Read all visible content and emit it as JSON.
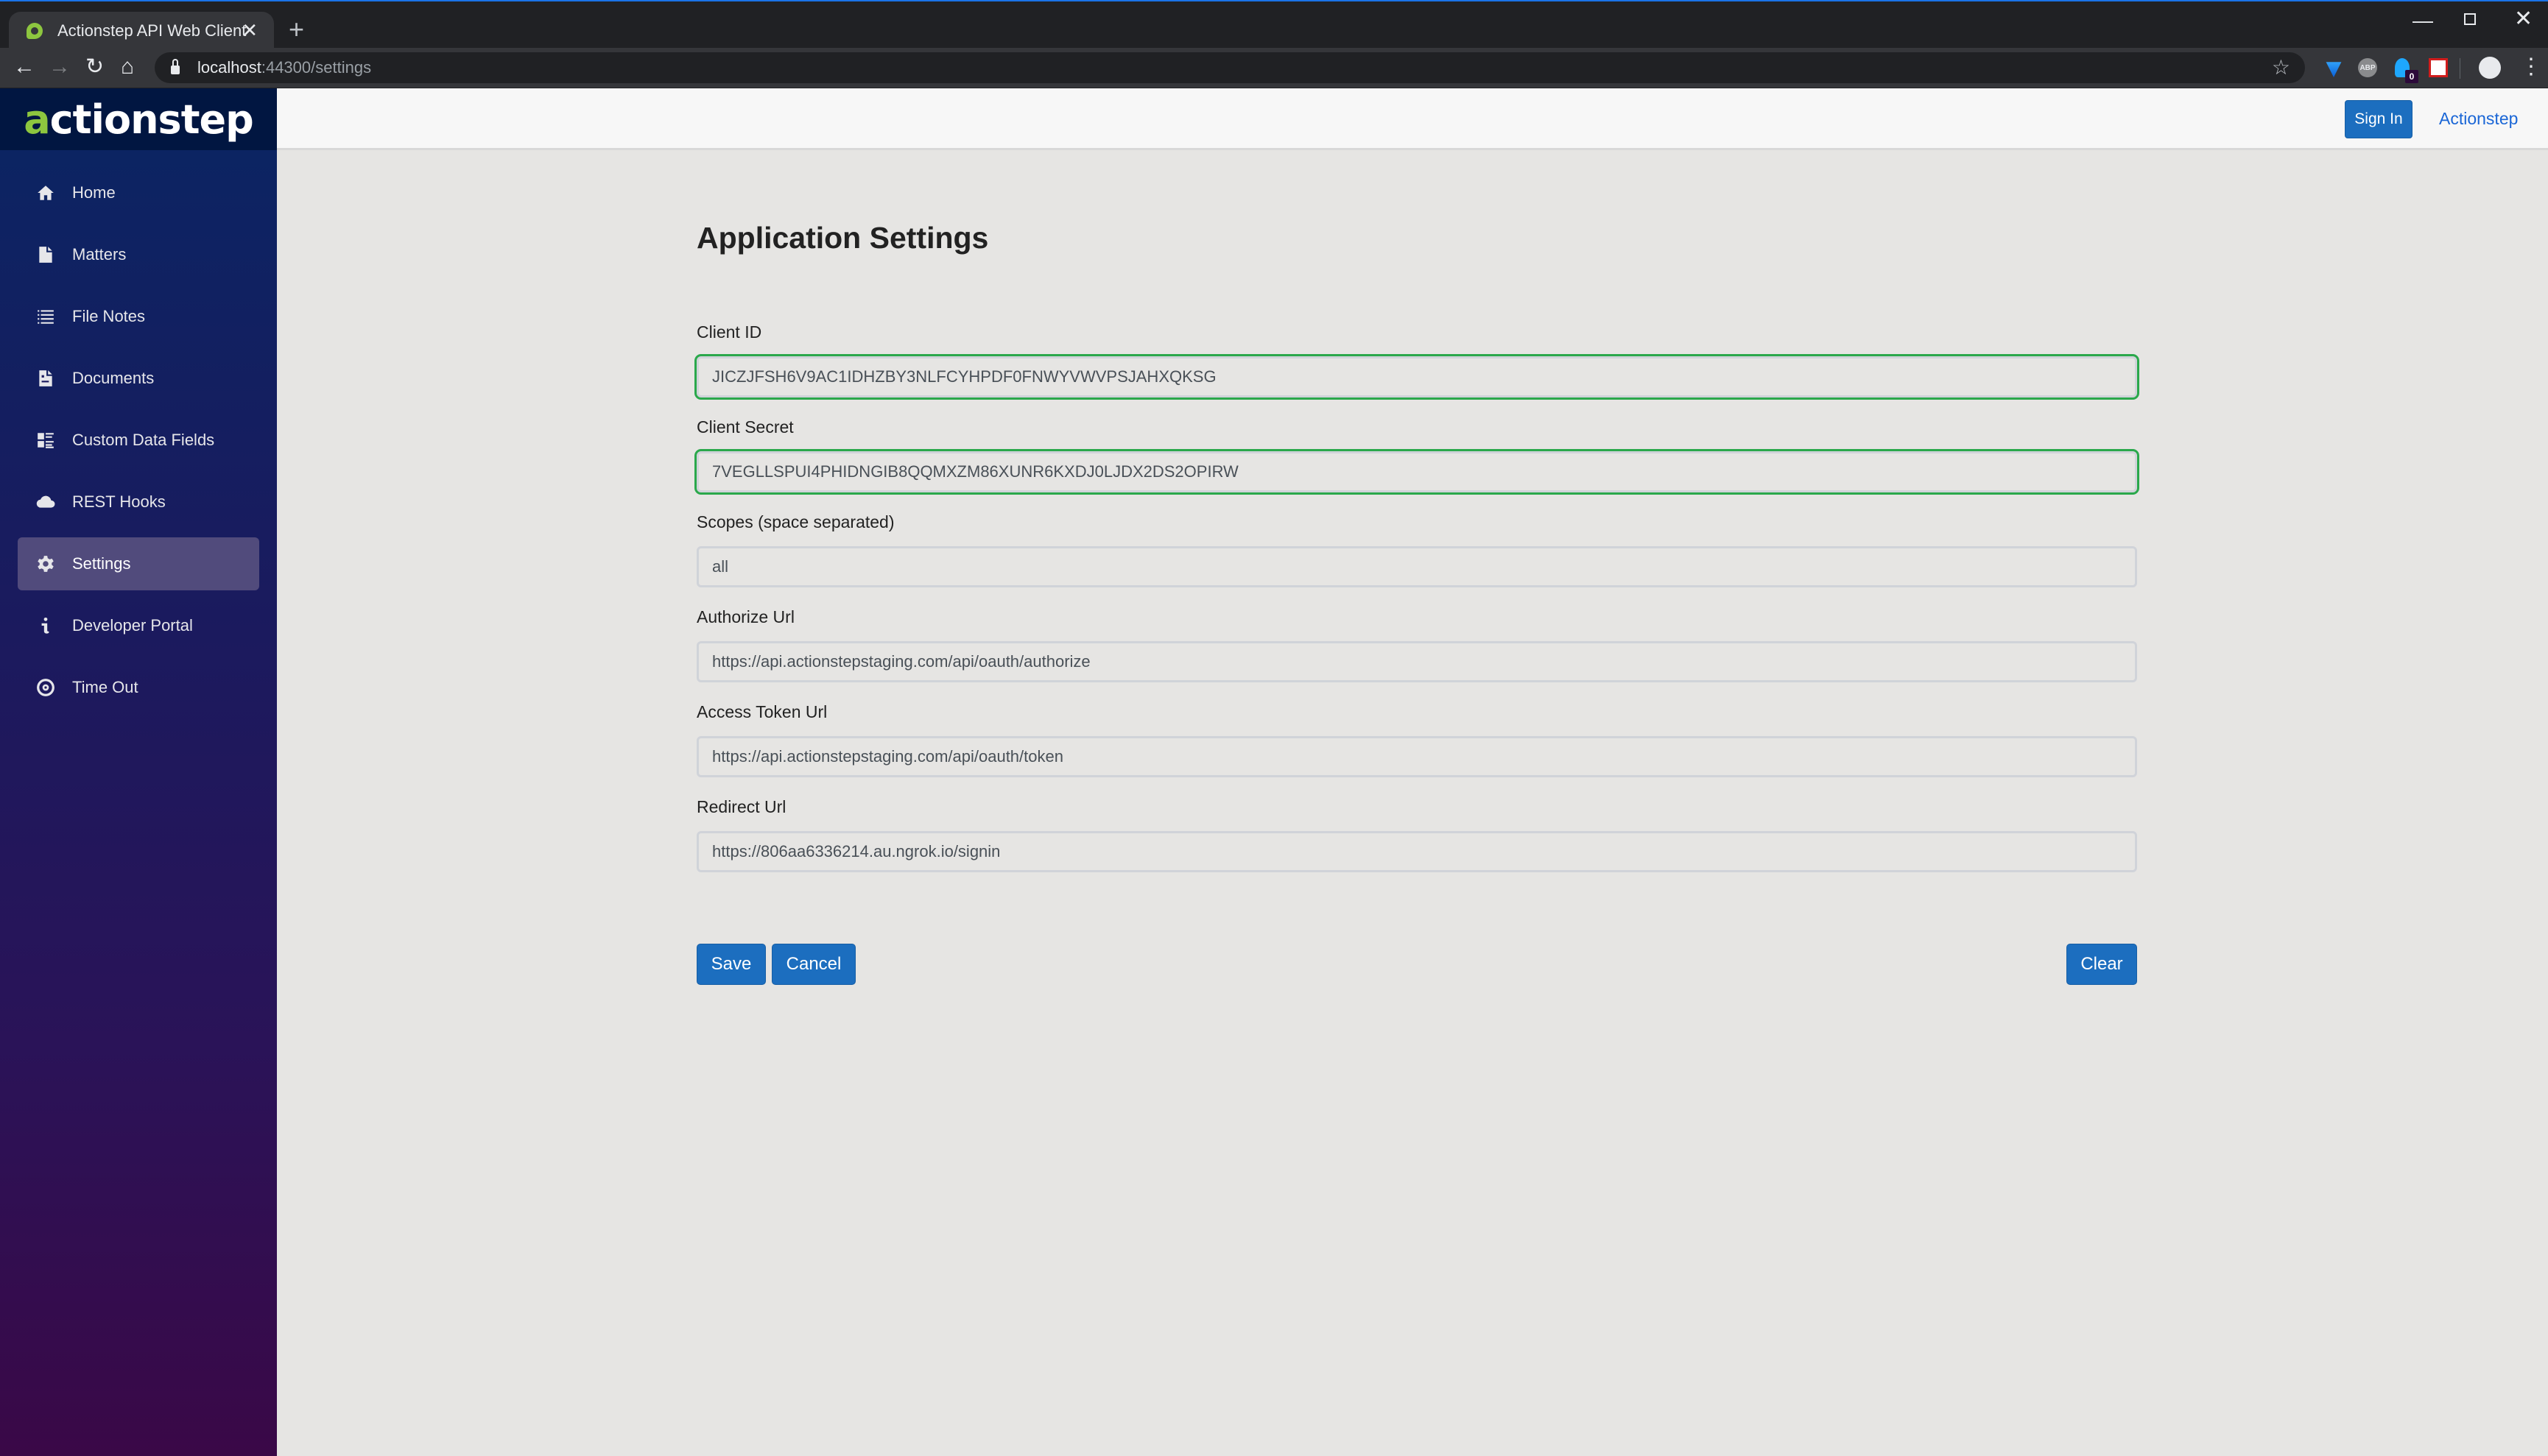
{
  "browser": {
    "tab_title": "Actionstep API Web Client",
    "url_host": "localhost",
    "url_rest": ":44300/settings",
    "extensions": [
      "gem-extension-icon",
      "adblock-plus-icon",
      "ghostery-icon",
      "ghostbuster-extension-icon"
    ],
    "ghostery_badge": "0",
    "abp_label": "ABP"
  },
  "sidebar": {
    "logo_prefix": "a",
    "logo_rest": "ctionstep",
    "items": [
      {
        "label": "Home",
        "icon": "home-icon"
      },
      {
        "label": "Matters",
        "icon": "file-icon"
      },
      {
        "label": "File Notes",
        "icon": "list-icon"
      },
      {
        "label": "Documents",
        "icon": "document-icon"
      },
      {
        "label": "Custom Data Fields",
        "icon": "fields-icon"
      },
      {
        "label": "REST Hooks",
        "icon": "cloud-icon"
      },
      {
        "label": "Settings",
        "icon": "gear-icon",
        "active": true
      },
      {
        "label": "Developer Portal",
        "icon": "info-icon"
      },
      {
        "label": "Time Out",
        "icon": "target-icon"
      }
    ]
  },
  "header": {
    "signin_label": "Sign In",
    "link_label": "Actionstep"
  },
  "main": {
    "title": "Application Settings",
    "fields": [
      {
        "label": "Client ID",
        "value": "JICZJFSH6V9AC1IDHZBY3NLFCYHPDF0FNWYVWVPSJAHXQKSG",
        "valid": true
      },
      {
        "label": "Client Secret",
        "value": "7VEGLLSPUI4PHIDNGIB8QQMXZM86XUNR6KXDJ0LJDX2DS2OPIRW",
        "valid": true
      },
      {
        "label": "Scopes (space separated)",
        "value": "all"
      },
      {
        "label": "Authorize Url",
        "value": "https://api.actionstepstaging.com/api/oauth/authorize"
      },
      {
        "label": "Access Token Url",
        "value": "https://api.actionstepstaging.com/api/oauth/token"
      },
      {
        "label": "Redirect Url",
        "value": "https://806aa6336214.au.ngrok.io/signin"
      }
    ],
    "buttons": {
      "save": "Save",
      "cancel": "Cancel",
      "clear": "Clear"
    }
  },
  "colors": {
    "primary": "#1c6ebf",
    "valid_outline": "#2aa84b",
    "sidebar_top": "#0a2563",
    "sidebar_bottom": "#3a0847",
    "logo_accent": "#8dc63f"
  }
}
